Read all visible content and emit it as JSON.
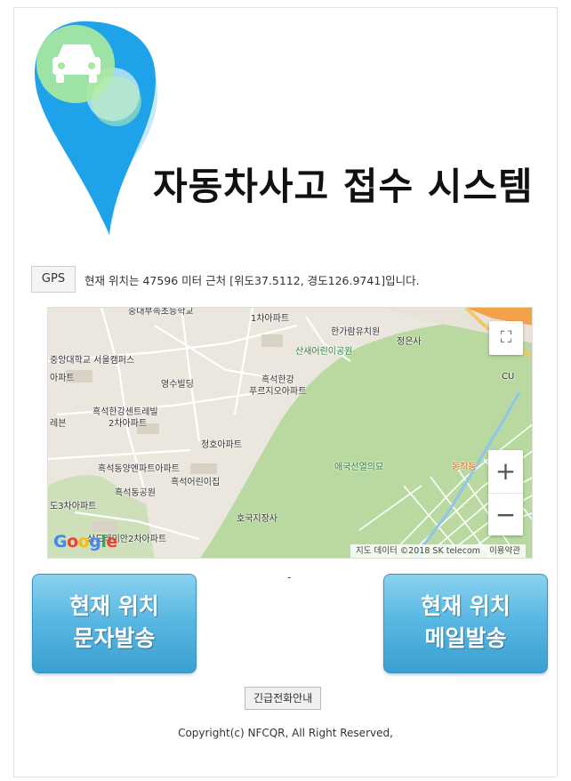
{
  "header": {
    "title": "자동차사고 접수 시스템",
    "logo_icon": "car-location-pin-icon"
  },
  "location": {
    "gps_button": "GPS",
    "status_text": "현재 위치는 47596 미터 근처 [위도37.5112, 경도126.9741]입니다."
  },
  "map": {
    "labels": [
      "중대부속초등학교",
      "1차아파트",
      "한가람유치원",
      "정은사",
      "산새어린이공원",
      "중앙대학교 서울캠퍼스",
      "아파트",
      "영수빌딩",
      "흑석한강",
      "푸르지오아파트",
      "흑석한강센트레빌",
      "2차아파트",
      "레븐",
      "청호아파트",
      "흑석동양엔파트아파트",
      "흑석어린이집",
      "애국선열의묘",
      "흑석동공원",
      "도3차아파트",
      "호국지장사",
      "상도래미안2차아파트",
      "동작동",
      "CU"
    ],
    "fullscreen_icon": "fullscreen-icon",
    "zoom_in": "+",
    "zoom_out": "−",
    "google_logo": "Google",
    "attribution": "지도 데이터 ©2018 SK telecom",
    "terms": "이용약관"
  },
  "separator": "-",
  "buttons": {
    "sms_line1": "현재 위치",
    "sms_line2": "문자발송",
    "mail_line1": "현재 위치",
    "mail_line2": "메일발송",
    "emergency": "긴급전화안내"
  },
  "footer": {
    "copyright": "Copyright(c) NFCQR, All Right Reserved,"
  },
  "colors": {
    "pin_blue": "#1ea3ea",
    "pin_green": "#a9e8a0",
    "button_blue": "#5ab8e3",
    "park_green": "#b9d9a1",
    "urban_gray": "#ebe7df"
  }
}
